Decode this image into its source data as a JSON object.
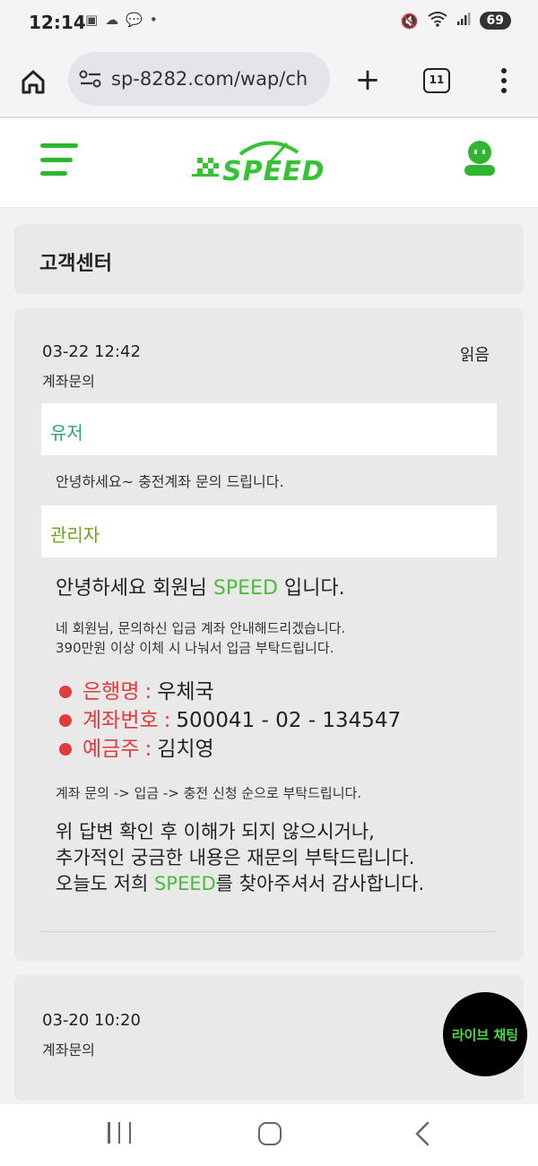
{
  "status": {
    "time": "12:14",
    "battery": "69"
  },
  "browser": {
    "url": "sp-8282.com/wap/ch",
    "tab_count": "11",
    "new_tab": "+"
  },
  "site": {
    "logo_text": "SPEED",
    "brand_color": "#35c335"
  },
  "page": {
    "title": "고객센터"
  },
  "messages": [
    {
      "date": "03-22 12:42",
      "status": "읽음",
      "type": "계좌문의",
      "user_label": "유저",
      "user_message": "안녕하세요~ 충전계좌 문의 드립니다.",
      "admin_label": "관리자",
      "admin_greeting_pre": "안녕하세요 회원님 ",
      "admin_greeting_brand": "SPEED",
      "admin_greeting_post": " 입니다.",
      "admin_p1_line1": "네 회원님, 문의하신 입금 계좌 안내해드리겠습니다.",
      "admin_p1_line2": "390만원 이상 이체 시 나눠서 입금 부탁드립니다.",
      "bank_info": [
        {
          "label": "은행명",
          "sep": ":",
          "value": "우체국"
        },
        {
          "label": "계좌번호",
          "sep": ":",
          "value": "500041 - 02 - 134547"
        },
        {
          "label": "예금주",
          "sep": ":",
          "value": "김치영"
        }
      ],
      "order_note": "계좌 문의 -> 입금 -> 충전 신청 순으로 부탁드립니다.",
      "closing_line1": "위 답변 확인 후 이해가 되지 않으시거나,",
      "closing_line2": "추가적인 궁금한 내용은 재문의 부탁드립니다.",
      "closing_line3_pre": "오늘도 저희 ",
      "closing_line3_brand": "SPEED",
      "closing_line3_post": "를 찾아주셔서 감사합니다."
    },
    {
      "date": "03-20 10:20",
      "type": "계좌문의"
    }
  ],
  "live_chat": {
    "label": "라이브 채팅"
  }
}
